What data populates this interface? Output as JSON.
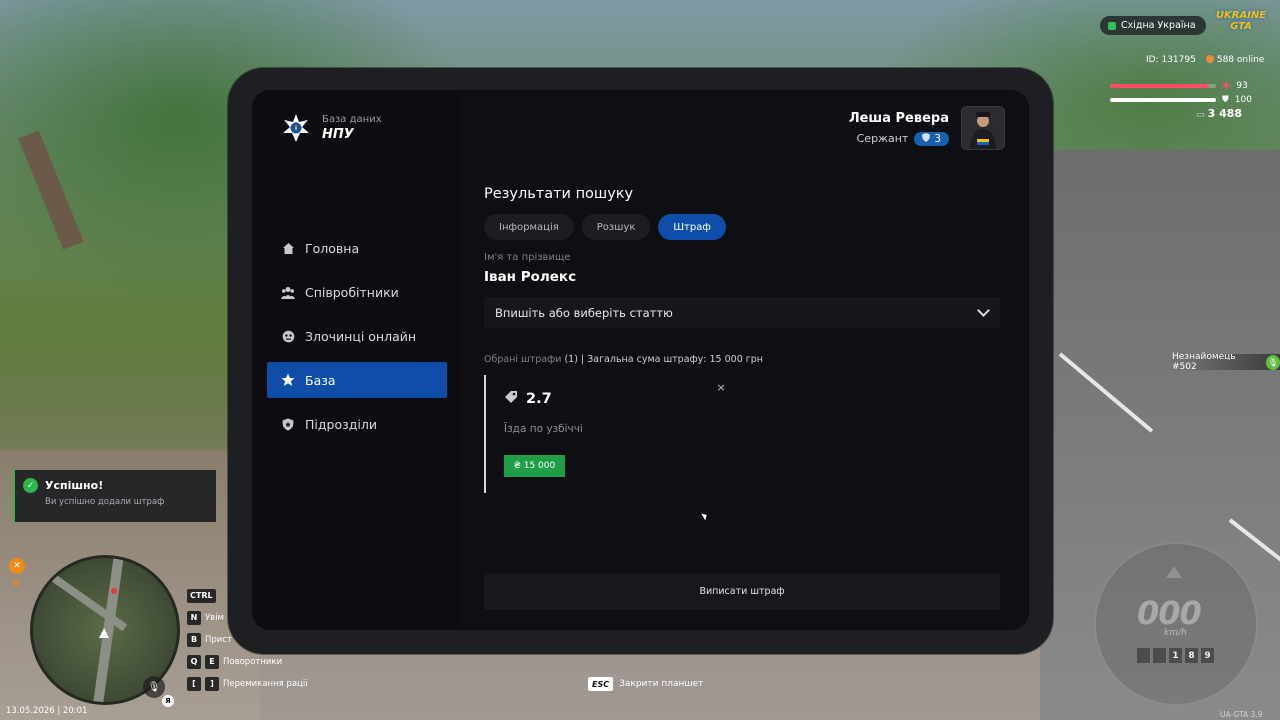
{
  "tablet": {
    "brand": {
      "subtitle": "База даних",
      "title": "НПУ"
    },
    "user": {
      "name": "Леша Ревера",
      "rank": "Сержант",
      "rank_level": "3"
    },
    "nav": [
      {
        "label": "Головна",
        "icon": "home-icon",
        "active": false
      },
      {
        "label": "Співробітники",
        "icon": "users-icon",
        "active": false
      },
      {
        "label": "Злочинці онлайн",
        "icon": "mask-icon",
        "active": false
      },
      {
        "label": "База",
        "icon": "star-icon",
        "active": true
      },
      {
        "label": "Підрозділи",
        "icon": "shield-icon",
        "active": false
      }
    ],
    "results_title": "Результати пошуку",
    "tabs": [
      {
        "label": "Інформація",
        "active": false
      },
      {
        "label": "Розшук",
        "active": false
      },
      {
        "label": "Штраф",
        "active": true
      }
    ],
    "name_label": "Ім'я та прізвище",
    "name_value": "Іван Ролекс",
    "article_select": {
      "placeholder": "Впишіть або виберіть статтю"
    },
    "summary": {
      "prefix": "Обрані штрафи",
      "text": " (1) | Загальна сума штрафу: 15 000 грн"
    },
    "fine": {
      "code": "2.7",
      "description": "Їзда по узбіччі",
      "currency": "₴",
      "amount": "15 000",
      "close": "×"
    },
    "issue_button": "Виписати штраф"
  },
  "hud": {
    "region": "Східна Україна",
    "logo_line1": "UKRAINE",
    "logo_line2": "GTA",
    "player_id": "ID: 131795",
    "online": "588 online",
    "health": {
      "value": "93",
      "fraction": 0.93,
      "color": "#ff4d6a"
    },
    "armor": {
      "value": "100",
      "fraction": 1.0,
      "color": "#ffffff"
    },
    "money": "3 488",
    "stranger": "Незнайомець #502",
    "toast": {
      "title": "Успішно!",
      "subtitle": "Ви успішно додали штраф"
    },
    "weapon_count": "0",
    "datetime": "13.05.2026 | 20:01",
    "language": "Я",
    "keys": [
      {
        "keys": [
          "CTRL"
        ],
        "label": ""
      },
      {
        "keys": [
          "N"
        ],
        "label": "Увім"
      },
      {
        "keys": [
          "B"
        ],
        "label": "Прист"
      },
      {
        "keys": [
          "Q",
          "E"
        ],
        "label": "Поворотники"
      },
      {
        "keys": [
          "[",
          "]"
        ],
        "label": "Перемикання раціі"
      }
    ],
    "esc_key": "ESC",
    "esc_label": "Закрити планшет",
    "speed": "000",
    "speed_unit": "km/h",
    "odometer": [
      "",
      "",
      "1",
      "8",
      "9"
    ],
    "version": "UA-GTA 3.9"
  }
}
